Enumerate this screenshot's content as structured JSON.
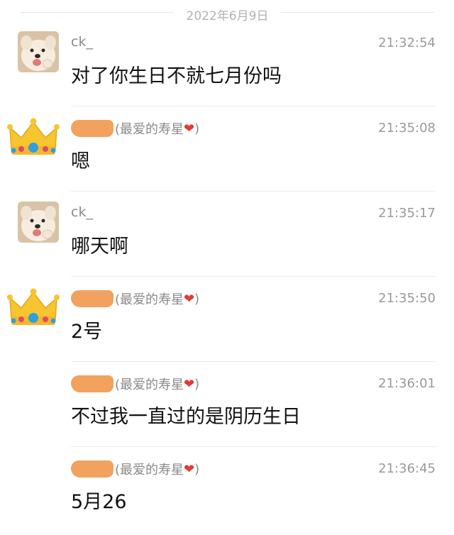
{
  "date_divider": "2022年6月9日",
  "messages": [
    {
      "sender": "ck_",
      "avatar": "dog-avatar",
      "time": "21:32:54",
      "text": "对了你生日不就七月份吗"
    },
    {
      "sender_alias": "(最爱的寿星",
      "sender_alias_end": ")",
      "avatar": "crown-avatar",
      "time": "21:35:08",
      "text": "嗯"
    },
    {
      "sender": "ck_",
      "avatar": "dog-avatar",
      "time": "21:35:17",
      "text": "哪天啊"
    },
    {
      "sender_alias": "(最爱的寿星",
      "sender_alias_end": ")",
      "avatar": "crown-avatar",
      "time": "21:35:50",
      "text": "2号"
    },
    {
      "sender_alias": "(最爱的寿星",
      "sender_alias_end": ")",
      "avatar": "none",
      "time": "21:36:01",
      "text": "不过我一直过的是阴历生日"
    },
    {
      "sender_alias": "(最爱的寿星",
      "sender_alias_end": ")",
      "avatar": "none",
      "time": "21:36:45",
      "text": "5月26"
    }
  ],
  "colors": {
    "redaction": "#f2a25e",
    "heart": "#e53935",
    "time": "#9a9a9a"
  }
}
